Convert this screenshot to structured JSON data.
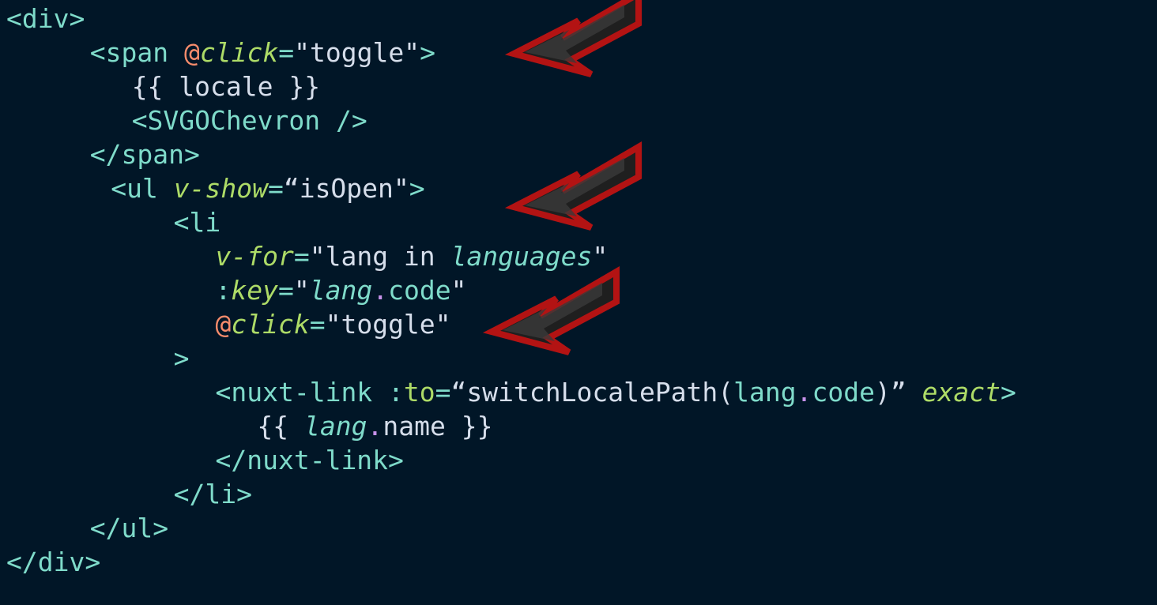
{
  "theme": {
    "background": "#011627",
    "colors": {
      "tag": "#7fdbca",
      "text": "#d6deeb",
      "attr": "#addb67",
      "at": "#f78c6c",
      "string": "#ecc48d",
      "dot": "#c792ea",
      "arrow": "#b31313"
    }
  },
  "code": {
    "lines": [
      {
        "indent": 0,
        "tokens": [
          {
            "t": "<div>",
            "c": "tag"
          }
        ]
      },
      {
        "indent": 4,
        "tokens": [
          {
            "t": "<span ",
            "c": "tag"
          },
          {
            "t": "@",
            "c": "at"
          },
          {
            "t": "click",
            "c": "attr",
            "i": true
          },
          {
            "t": "=",
            "c": "tag"
          },
          {
            "t": "\"toggle\"",
            "c": "text"
          },
          {
            "t": ">",
            "c": "tag"
          }
        ]
      },
      {
        "indent": 6,
        "tokens": [
          {
            "t": "{{ locale }}",
            "c": "text"
          }
        ]
      },
      {
        "indent": 6,
        "tokens": [
          {
            "t": "<SVGOChevron />",
            "c": "tag"
          }
        ]
      },
      {
        "indent": 4,
        "tokens": [
          {
            "t": "</span>",
            "c": "tag"
          }
        ]
      },
      {
        "indent": 5,
        "tokens": [
          {
            "t": "<ul ",
            "c": "tag"
          },
          {
            "t": "v-show",
            "c": "attr",
            "i": true
          },
          {
            "t": "=",
            "c": "tag"
          },
          {
            "t": "“isOpen\"",
            "c": "text"
          },
          {
            "t": ">",
            "c": "tag"
          }
        ]
      },
      {
        "indent": 8,
        "tokens": [
          {
            "t": "<li",
            "c": "tag"
          }
        ]
      },
      {
        "indent": 10,
        "tokens": [
          {
            "t": "v-for",
            "c": "attr",
            "i": true
          },
          {
            "t": "=",
            "c": "tag"
          },
          {
            "t": "\"lang in ",
            "c": "text"
          },
          {
            "t": "languages",
            "c": "tag",
            "i": true
          },
          {
            "t": "\"",
            "c": "text"
          }
        ]
      },
      {
        "indent": 10,
        "tokens": [
          {
            "t": ":",
            "c": "tag"
          },
          {
            "t": "key",
            "c": "attr",
            "i": true
          },
          {
            "t": "=",
            "c": "tag"
          },
          {
            "t": "\"",
            "c": "text"
          },
          {
            "t": "lang",
            "c": "tag",
            "i": true
          },
          {
            "t": ".",
            "c": "dot"
          },
          {
            "t": "code",
            "c": "tag"
          },
          {
            "t": "\"",
            "c": "text"
          }
        ]
      },
      {
        "indent": 10,
        "tokens": [
          {
            "t": "@",
            "c": "at"
          },
          {
            "t": "click",
            "c": "attr",
            "i": true
          },
          {
            "t": "=",
            "c": "tag"
          },
          {
            "t": "\"toggle\"",
            "c": "text"
          }
        ]
      },
      {
        "indent": 8,
        "tokens": [
          {
            "t": ">",
            "c": "tag"
          }
        ]
      },
      {
        "indent": 10,
        "tokens": [
          {
            "t": "<nuxt-link ",
            "c": "tag"
          },
          {
            "t": ":",
            "c": "tag"
          },
          {
            "t": "to",
            "c": "attr"
          },
          {
            "t": "=",
            "c": "tag"
          },
          {
            "t": "“switchLocalePath(",
            "c": "text"
          },
          {
            "t": "lang",
            "c": "tag"
          },
          {
            "t": ".",
            "c": "dot"
          },
          {
            "t": "code",
            "c": "tag"
          },
          {
            "t": ")” ",
            "c": "text"
          },
          {
            "t": "exact",
            "c": "attr",
            "i": true
          },
          {
            "t": ">",
            "c": "tag"
          }
        ]
      },
      {
        "indent": 12,
        "tokens": [
          {
            "t": "{{ ",
            "c": "text"
          },
          {
            "t": "lang",
            "c": "tag",
            "i": true
          },
          {
            "t": ".",
            "c": "dot"
          },
          {
            "t": "name }}",
            "c": "text"
          }
        ]
      },
      {
        "indent": 10,
        "tokens": [
          {
            "t": "</nuxt-link>",
            "c": "tag"
          }
        ]
      },
      {
        "indent": 8,
        "tokens": [
          {
            "t": "</li>",
            "c": "tag"
          }
        ]
      },
      {
        "indent": 4,
        "tokens": [
          {
            "t": "</ul>",
            "c": "tag"
          }
        ]
      },
      {
        "indent": 0,
        "tokens": [
          {
            "t": "</div>",
            "c": "tag"
          }
        ]
      }
    ]
  },
  "annotations": {
    "arrows": [
      {
        "points_to_line": 2
      },
      {
        "points_to_line": 6
      },
      {
        "points_to_line": 10
      }
    ]
  }
}
